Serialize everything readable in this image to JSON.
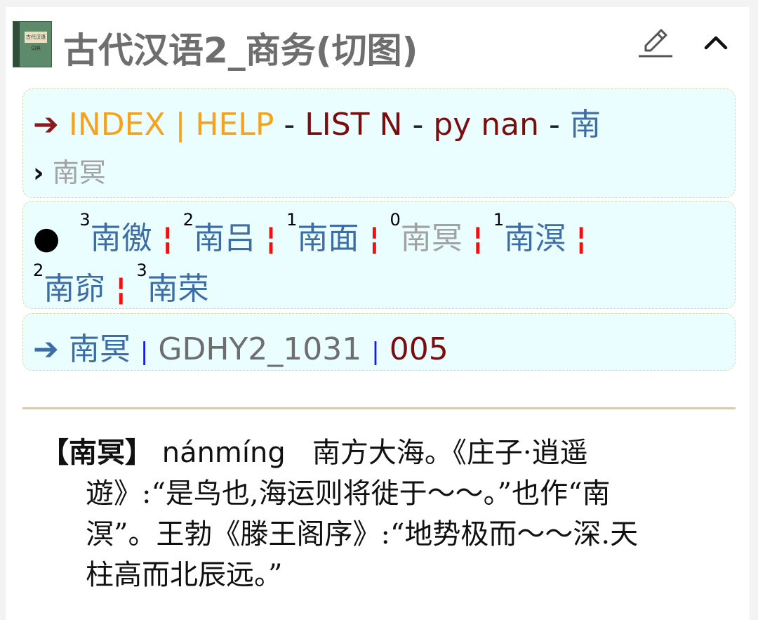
{
  "header": {
    "title": "古代汉语2_商务(切图)",
    "book_label": "古代汉语词典"
  },
  "nav": {
    "arrow": "➔",
    "index": "INDEX",
    "sep": "|",
    "help": "HELP",
    "dash1": "-",
    "list": "LIST N",
    "dash2": "-",
    "py": "py nan",
    "dash3": "-",
    "head_char": "南",
    "chevron": "›",
    "current": "南冥"
  },
  "related": {
    "bullet": "●",
    "items": [
      {
        "tone": "3",
        "word": "南徼",
        "active": false
      },
      {
        "tone": "2",
        "word": "南吕",
        "active": false
      },
      {
        "tone": "1",
        "word": "南面",
        "active": false
      },
      {
        "tone": "0",
        "word": "南冥",
        "active": true
      },
      {
        "tone": "1",
        "word": "南溟",
        "active": false
      },
      {
        "tone": "2",
        "word": "南窌",
        "active": false
      },
      {
        "tone": "3",
        "word": "南荣",
        "active": false
      }
    ],
    "sep": "¦"
  },
  "source": {
    "arrow": "➔",
    "word": "南冥",
    "sep": "|",
    "id": "GDHY2_1031",
    "page": "005"
  },
  "definition": {
    "headword": "【南冥】",
    "pinyin": "nánmíng",
    "line1": "南方大海。《庄子·逍遥",
    "line2": "遊》:“是鸟也,海运则将徙于～～。”也作“南",
    "line3": "溟”。王勃《滕王阁序》:“地势极而～～深.天",
    "line4": "柱高而北辰远。”"
  },
  "colors": {
    "index": "#f5a31f",
    "list": "#7a0e0e",
    "link": "#3c6ea5",
    "inactive": "#a2a2a2",
    "separator": "#ee1111",
    "box_bg": "#eafdff"
  }
}
